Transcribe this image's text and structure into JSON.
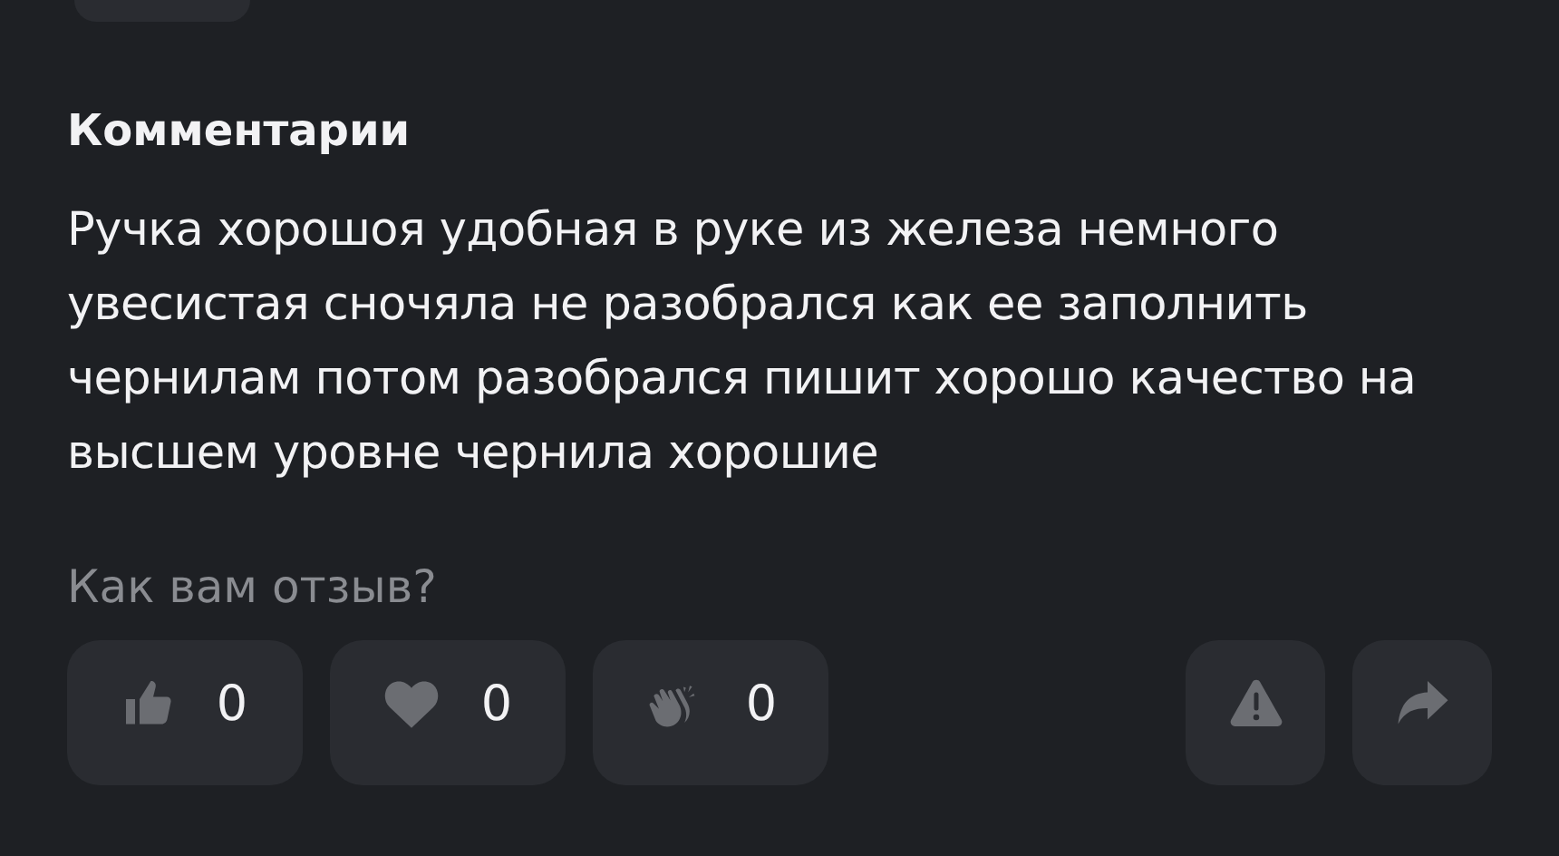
{
  "section_title": "Комментарии",
  "comment": "Ручка хорошоя удобная в руке из железа немного увесистая сночяла не разобрался как ее заполнить чернилам потом разобрался пишит хорошо качество на высшем уровне чернила хорошие",
  "prompt": "Как вам отзыв?",
  "reactions": [
    {
      "kind": "like",
      "count": "0"
    },
    {
      "kind": "heart",
      "count": "0"
    },
    {
      "kind": "clap",
      "count": "0"
    }
  ],
  "actions": [
    {
      "kind": "report"
    },
    {
      "kind": "share"
    }
  ]
}
